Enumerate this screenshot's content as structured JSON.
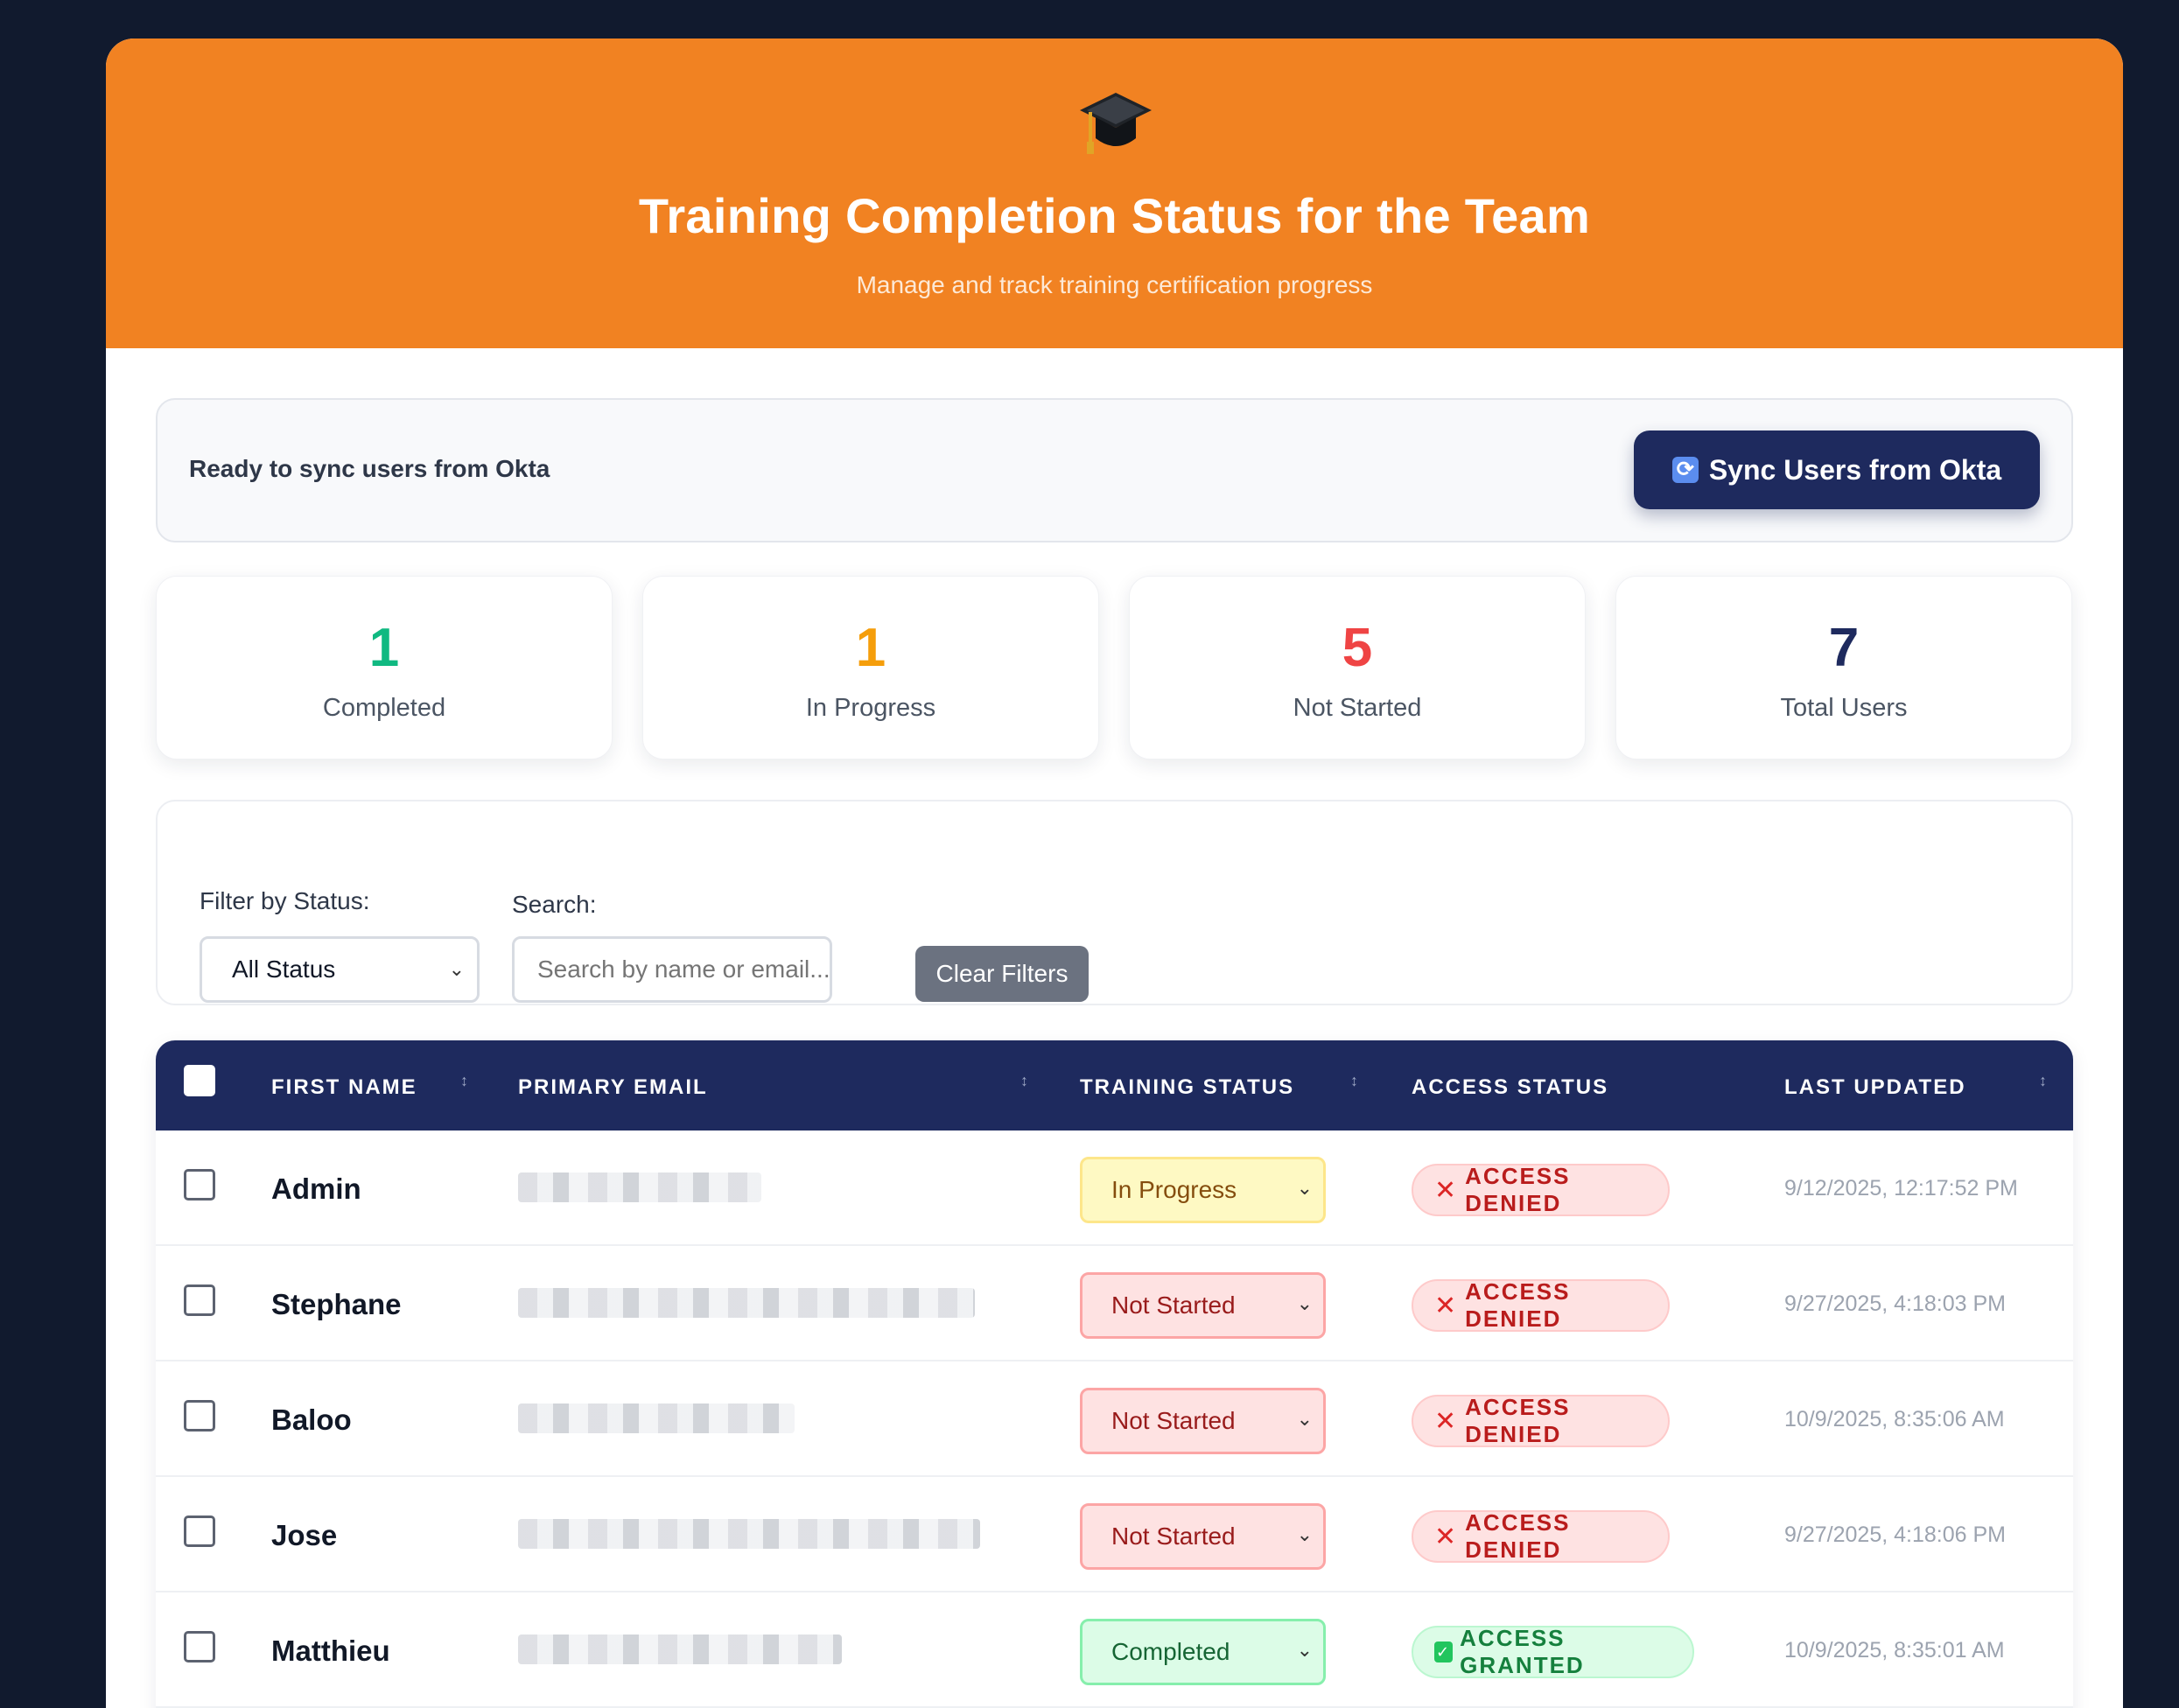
{
  "header": {
    "icon": "graduation-cap-icon",
    "title": "Training Completion Status for the Team",
    "subtitle": "Manage and track training certification progress"
  },
  "sync": {
    "status_text": "Ready to sync users from Okta",
    "button_label": "Sync Users from Okta",
    "button_icon": "sync-icon"
  },
  "stats": [
    {
      "value": "1",
      "label": "Completed",
      "color": "#10b981"
    },
    {
      "value": "1",
      "label": "In Progress",
      "color": "#f59e0b"
    },
    {
      "value": "5",
      "label": "Not Started",
      "color": "#ef4444"
    },
    {
      "value": "7",
      "label": "Total Users",
      "color": "#1e2a5e"
    }
  ],
  "filters": {
    "status_label": "Filter by Status:",
    "status_value": "All Status",
    "search_label": "Search:",
    "search_placeholder": "Search by name or email...",
    "clear_label": "Clear Filters"
  },
  "table": {
    "columns": [
      "FIRST NAME",
      "PRIMARY EMAIL",
      "TRAINING STATUS",
      "ACCESS STATUS",
      "LAST UPDATED"
    ],
    "rows": [
      {
        "first_name": "Admin",
        "training_status": "In Progress",
        "access_status": "ACCESS DENIED",
        "last_updated": "9/12/2025, 12:17:52 PM"
      },
      {
        "first_name": "Stephane",
        "training_status": "Not Started",
        "access_status": "ACCESS DENIED",
        "last_updated": "9/27/2025, 4:18:03 PM"
      },
      {
        "first_name": "Baloo",
        "training_status": "Not Started",
        "access_status": "ACCESS DENIED",
        "last_updated": "10/9/2025, 8:35:06 AM"
      },
      {
        "first_name": "Jose",
        "training_status": "Not Started",
        "access_status": "ACCESS DENIED",
        "last_updated": "9/27/2025, 4:18:06 PM"
      },
      {
        "first_name": "Matthieu",
        "training_status": "Completed",
        "access_status": "ACCESS GRANTED",
        "last_updated": "10/9/2025, 8:35:01 AM"
      }
    ]
  },
  "colors": {
    "brand_orange": "#f18222",
    "navy": "#1e2a5e",
    "background": "#111a2e"
  }
}
